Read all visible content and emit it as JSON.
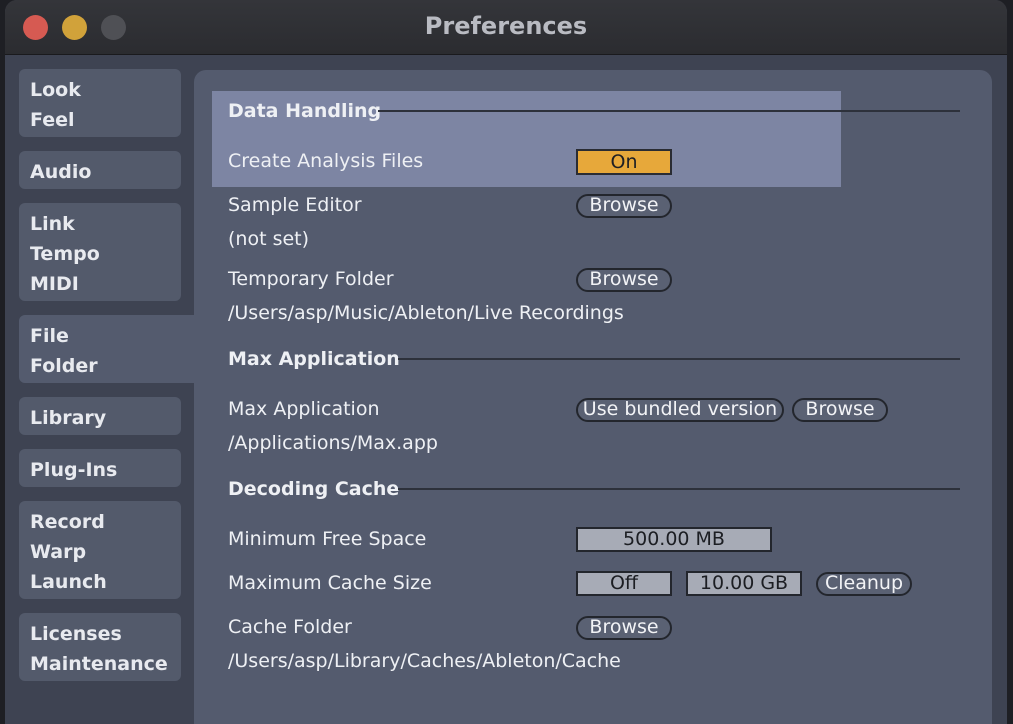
{
  "window": {
    "title": "Preferences"
  },
  "sidebar": {
    "tabs": [
      {
        "lines": [
          "Look",
          "Feel"
        ]
      },
      {
        "lines": [
          "Audio"
        ]
      },
      {
        "lines": [
          "Link",
          "Tempo",
          "MIDI"
        ]
      },
      {
        "lines": [
          "File",
          "Folder"
        ],
        "active": true
      },
      {
        "lines": [
          "Library"
        ]
      },
      {
        "lines": [
          "Plug-Ins"
        ]
      },
      {
        "lines": [
          "Record",
          "Warp",
          "Launch"
        ]
      },
      {
        "lines": [
          "Licenses",
          "Maintenance"
        ]
      }
    ]
  },
  "data_handling": {
    "heading": "Data Handling",
    "create_analysis_label": "Create Analysis Files",
    "create_analysis_value": "On",
    "sample_editor_label": "Sample Editor",
    "sample_editor_button": "Browse",
    "sample_editor_path": "(not set)",
    "temp_folder_label": "Temporary Folder",
    "temp_folder_button": "Browse",
    "temp_folder_path": "/Users/asp/Music/Ableton/Live Recordings"
  },
  "max_application": {
    "heading": "Max Application",
    "label": "Max Application",
    "bundled_button": "Use bundled version",
    "browse_button": "Browse",
    "path": "/Applications/Max.app"
  },
  "decoding_cache": {
    "heading": "Decoding Cache",
    "min_free_label": "Minimum Free Space",
    "min_free_value": "500.00 MB",
    "max_size_label": "Maximum Cache Size",
    "max_size_toggle": "Off",
    "max_size_value": "10.00 GB",
    "cleanup_button": "Cleanup",
    "cache_folder_label": "Cache Folder",
    "cache_folder_button": "Browse",
    "cache_folder_path": "/Users/asp/Library/Caches/Ableton/Cache"
  },
  "colors": {
    "accent_on": "#e7a83a",
    "panel": "#545b6e",
    "highlight": "#7d85a3"
  }
}
